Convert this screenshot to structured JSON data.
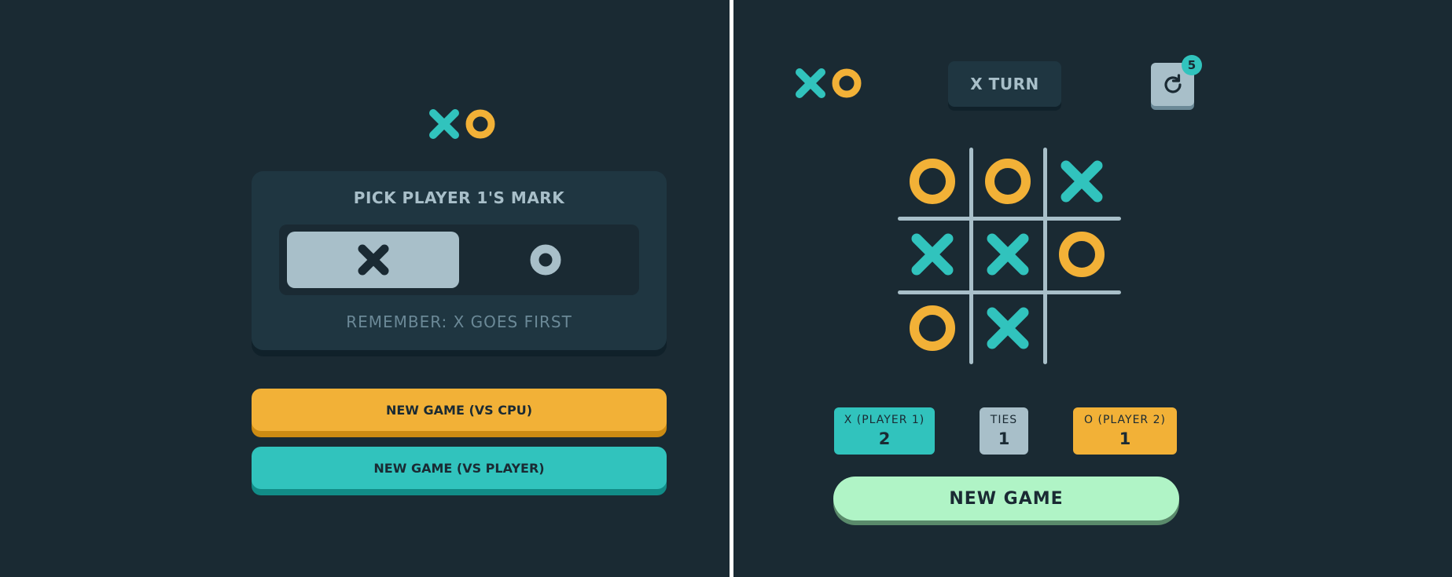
{
  "colors": {
    "background": "#1a2a33",
    "card": "#1f3641",
    "silver": "#a8bfc9",
    "teal": "#31c3bd",
    "yellow": "#f2b137",
    "mint": "#b0f4c6"
  },
  "setup": {
    "logo": {
      "x_icon": "x-icon",
      "o_icon": "o-icon"
    },
    "picker": {
      "title": "PICK PLAYER 1'S MARK",
      "options": [
        "X",
        "O"
      ],
      "selected": "X",
      "hint": "REMEMBER: X GOES FIRST"
    },
    "buttons": {
      "vs_cpu": "NEW GAME (VS CPU)",
      "vs_player": "NEW GAME (VS PLAYER)"
    }
  },
  "game": {
    "turn_label": "X TURN",
    "restart": {
      "icon": "restart-icon",
      "badge": "5"
    },
    "board": [
      [
        "O",
        "O",
        "X"
      ],
      [
        "X",
        "X",
        "O"
      ],
      [
        "O",
        "X",
        ""
      ]
    ],
    "scores": {
      "x_label": "X (PLAYER 1)",
      "x_value": "2",
      "ties_label": "TIES",
      "ties_value": "1",
      "o_label": "O (PLAYER 2)",
      "o_value": "1"
    },
    "new_game": "NEW GAME"
  }
}
